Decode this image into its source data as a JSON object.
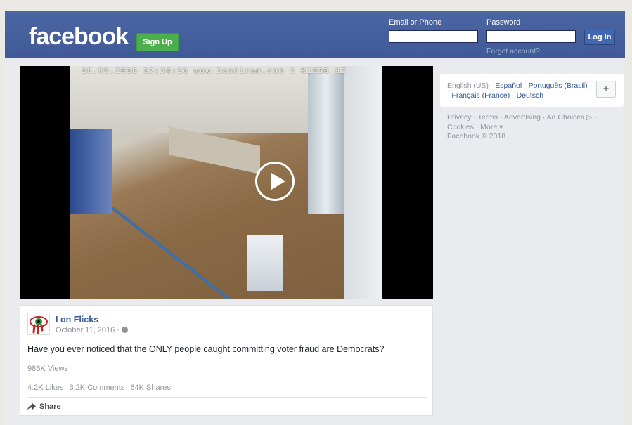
{
  "header": {
    "logo": "facebook",
    "signup_label": "Sign Up",
    "email_label": "Email or Phone",
    "email_value": "",
    "password_label": "Password",
    "password_value": "",
    "login_label": "Log In",
    "forgot_label": "Forgot account?",
    "brand_color": "#4267b2",
    "signup_color": "#4cae4c"
  },
  "video": {
    "overlay_text": "18.09.2016 12:34:36 www.Bandicam.com 1 K1958 НZ",
    "play_icon": "play-circle-icon"
  },
  "post": {
    "author": "I on Flicks",
    "date": "October 11, 2016",
    "date_separator": " · ",
    "privacy_icon": "globe-icon",
    "text": "Have you ever noticed that the ONLY people caught committing voter fraud are Democrats?",
    "views": "986K Views",
    "stats": {
      "likes": "4.2K Likes",
      "comments": "3.2K Comments",
      "shares": "64K Shares"
    },
    "share_label": "Share"
  },
  "languages": {
    "current": "English (US)",
    "items": [
      "Español",
      "Português (Brasil)",
      "Français (France)",
      "Deutsch"
    ],
    "more_button": "+"
  },
  "footer": {
    "links": [
      "Privacy",
      "Terms",
      "Advertising",
      "Ad Choices",
      "Cookies",
      "More"
    ],
    "copyright": "Facebook © 2018"
  }
}
